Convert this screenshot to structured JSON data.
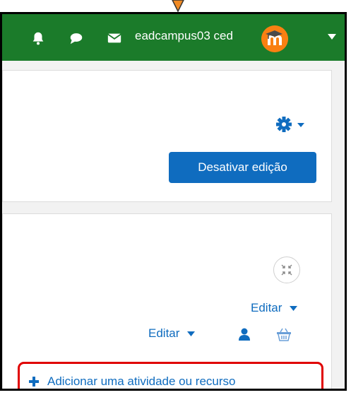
{
  "navbar": {
    "user_name": "eadcampus03 ced",
    "bg_color": "#1b7b2a",
    "icons": [
      "bell-icon",
      "chat-icon",
      "envelope-icon",
      "user-menu-caret-icon"
    ]
  },
  "header": {
    "settings_icon": "gear-icon",
    "edit_mode_button": "Desativar edição"
  },
  "section": {
    "collapse_icon": "collapse-all-icon",
    "edit_section": "Editar",
    "edit_item": "Editar",
    "add_activity": "Adicionar uma atividade ou recurso"
  },
  "colors": {
    "primary": "#0f6cbf",
    "highlight": "#e00000",
    "avatar": "#f98012"
  }
}
